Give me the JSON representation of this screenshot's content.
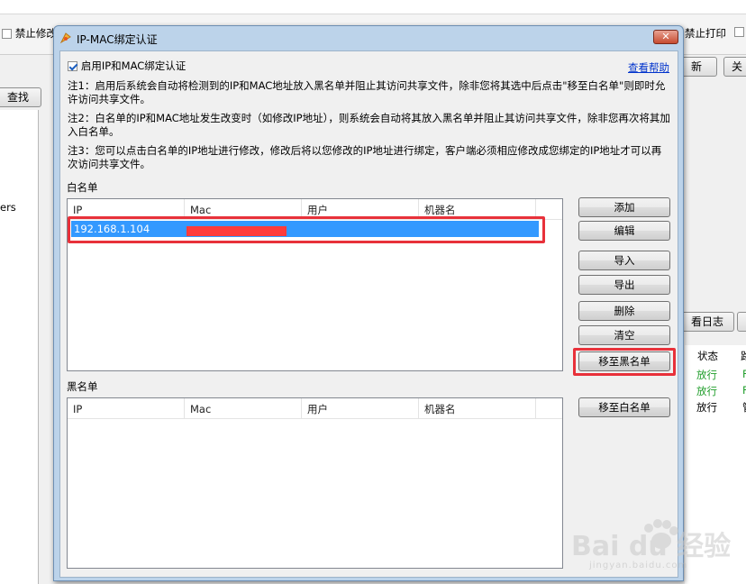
{
  "background_app": {
    "checkbox_left_label": "禁止修改",
    "checkbox_right_label": "禁止打印",
    "button_refresh_fragment": "新",
    "button_close_fragment": "关",
    "search_button_fragment": "查找",
    "left_list_fragment": "ers",
    "view_log_fragment": "看日志",
    "status_header": "状态",
    "status_header_next": "路",
    "status_rows": [
      {
        "status": "放行",
        "next": "F"
      },
      {
        "status": "放行",
        "next": "F"
      },
      {
        "status": "放行",
        "next": "管"
      }
    ]
  },
  "dialog": {
    "title": "IP-MAC绑定认证",
    "close_label": "✕",
    "enable_label": "启用IP和MAC绑定认证",
    "enable_checked": true,
    "help_link": "查看帮助",
    "note1": "注1：启用后系统会自动将检测到的IP和MAC地址放入黑名单并阻止其访问共享文件，除非您将其选中后点击\"移至白名单\"则即时允许访问共享文件。",
    "note2": "注2：白名单的IP和MAC地址发生改变时（如修改IP地址），则系统会自动将其放入黑名单并阻止其访问共享文件，除非您再次将其加入白名单。",
    "note3": "注3：您可以点击白名单的IP地址进行修改，修改后将以您修改的IP地址进行绑定，客户端必须相应修改成您绑定的IP地址才可以再次访问共享文件。",
    "whitelist_label": "白名单",
    "blacklist_label": "黑名单",
    "columns": [
      "IP",
      "Mac",
      "用户",
      "机器名"
    ],
    "whitelist_rows": [
      {
        "ip": "192.168.1.104",
        "mac": "",
        "user": "",
        "machine": ""
      }
    ],
    "blacklist_rows": [],
    "buttons": {
      "add": "添加",
      "edit": "编辑",
      "import": "导入",
      "export": "导出",
      "delete": "删除",
      "clear": "清空",
      "move_to_blacklist": "移至黑名单",
      "move_to_whitelist": "移至白名单"
    }
  },
  "watermark": {
    "brand": "Bai du 经验",
    "url": "jingyan.baidu.com"
  },
  "colors": {
    "selection": "#3399ff",
    "highlight": "#e8313a",
    "redaction": "#ff3b3b",
    "link": "#0033cc"
  }
}
